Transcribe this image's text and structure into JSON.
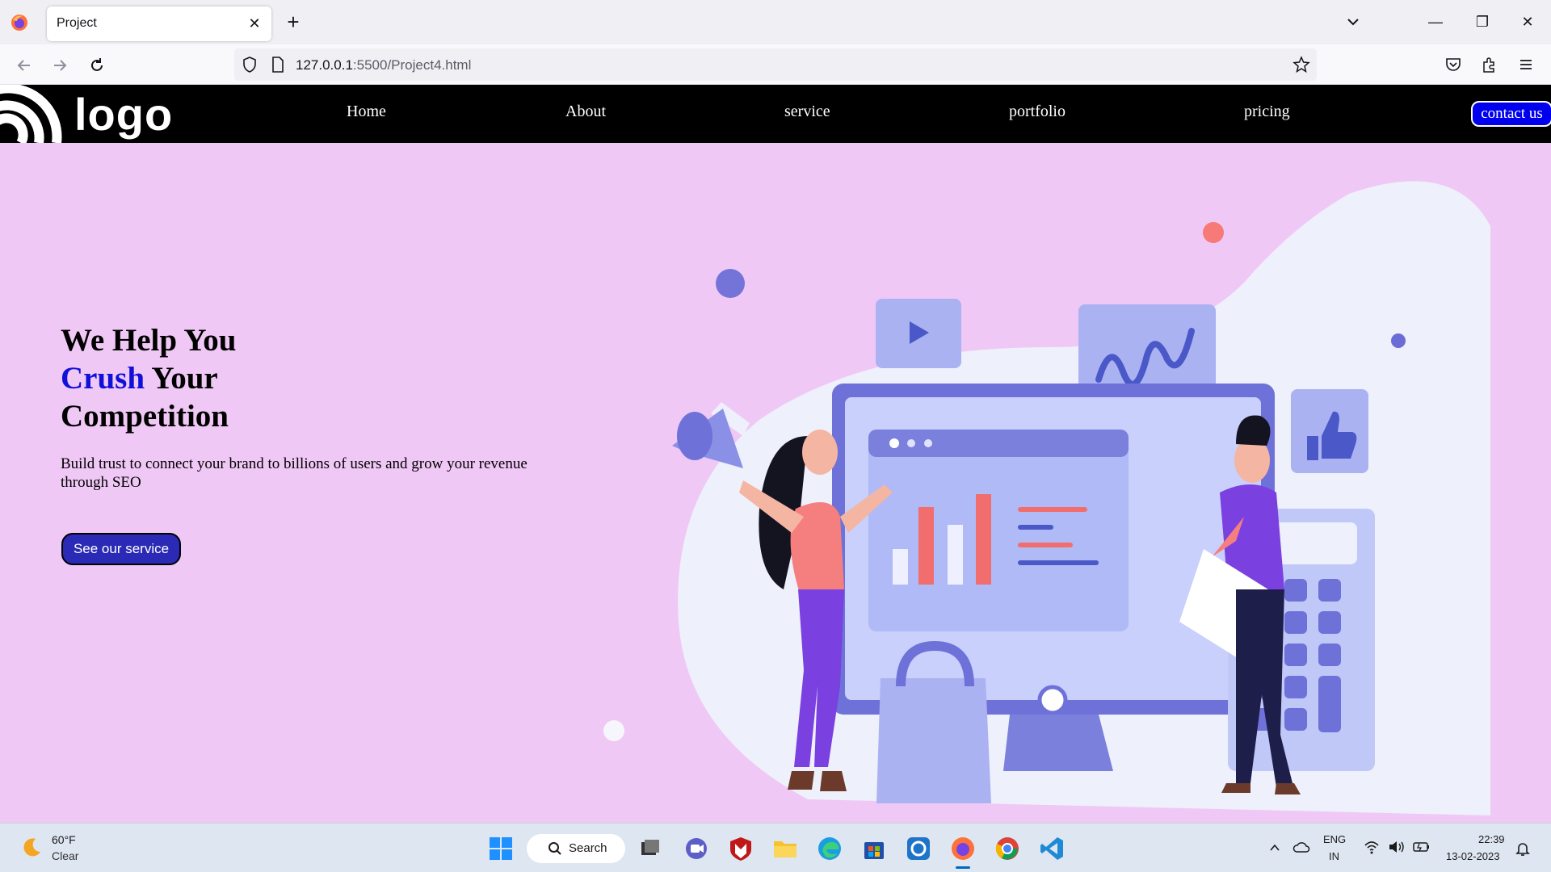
{
  "browser": {
    "tab_title": "Project",
    "tab_close": "✕",
    "new_tab": "+",
    "url_host": "127.0.0.1",
    "url_path": ":5500/Project4.html",
    "window_controls": {
      "minimize": "—",
      "restore": "❐",
      "close": "✕"
    }
  },
  "site": {
    "logo": "logo",
    "menu": [
      "Home",
      "About",
      "service",
      "portfolio",
      "pricing"
    ],
    "contact_label": "contact us",
    "hero": {
      "title_line1": "We Help You",
      "title_accent": "Crush",
      "title_line2_rest": " Your",
      "title_line3": "Competition",
      "subtitle": "Build trust to connect your brand to billions of users and grow your revenue through SEO",
      "cta_label": "See our service"
    },
    "colors": {
      "page_bg": "#f0c8f5",
      "header_bg": "#000000",
      "accent_text": "#1010d8",
      "button_bg": "#2a2ab6",
      "contact_bg": "#0000ee"
    }
  },
  "taskbar": {
    "weather_temp": "60°F",
    "weather_desc": "Clear",
    "search_label": "Search",
    "lang_line1": "ENG",
    "lang_line2": "IN",
    "time": "22:39",
    "date": "13-02-2023",
    "icons": [
      "windows-start-icon",
      "search-icon",
      "task-view-icon",
      "chat-icon",
      "mcafee-icon",
      "file-explorer-icon",
      "edge-icon",
      "store-icon",
      "app-icon",
      "firefox-icon",
      "chrome-icon",
      "vscode-icon"
    ]
  }
}
